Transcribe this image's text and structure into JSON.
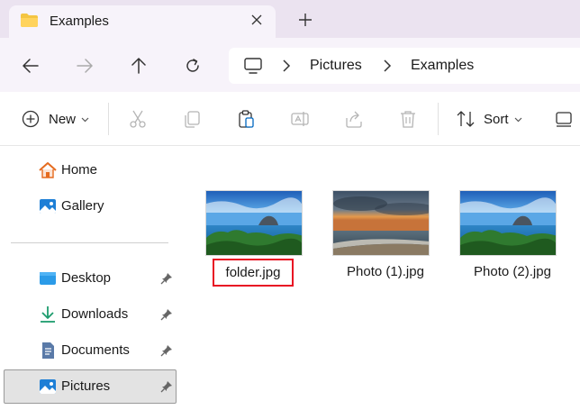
{
  "window": {
    "tab_title": "Examples",
    "new_tab_symbol": "+",
    "close_symbol": "✕"
  },
  "navigation": {
    "back": "back-arrow-icon",
    "forward": "forward-arrow-icon",
    "up": "up-arrow-icon",
    "refresh": "refresh-icon",
    "breadcrumb": [
      "Pictures",
      "Examples"
    ]
  },
  "toolbar": {
    "new_label": "New",
    "sort_label": "Sort",
    "icons": [
      "cut-icon",
      "copy-icon",
      "paste-icon",
      "rename-icon",
      "share-icon",
      "delete-icon"
    ]
  },
  "sidebar": {
    "items": [
      {
        "label": "Home",
        "icon": "home-icon",
        "pinned": false
      },
      {
        "label": "Gallery",
        "icon": "gallery-icon",
        "pinned": false
      },
      {
        "label": "Desktop",
        "icon": "desktop-icon",
        "pinned": true
      },
      {
        "label": "Downloads",
        "icon": "downloads-icon",
        "pinned": true
      },
      {
        "label": "Documents",
        "icon": "documents-icon",
        "pinned": true
      },
      {
        "label": "Pictures",
        "icon": "pictures-icon",
        "pinned": true,
        "selected": true
      }
    ]
  },
  "files": [
    {
      "name": "folder.jpg",
      "renaming": true
    },
    {
      "name": "Photo (1).jpg"
    },
    {
      "name": "Photo (2).jpg"
    }
  ],
  "colors": {
    "accent": "#0067c0",
    "rename_border": "#e81123",
    "folder_yellow": "#f4c542"
  }
}
